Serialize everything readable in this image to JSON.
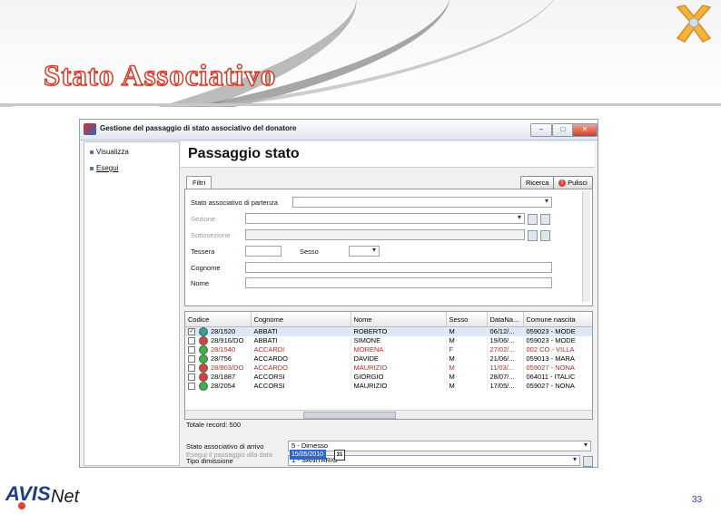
{
  "slide": {
    "title": "Stato Associativo",
    "page_number": "33",
    "logo_text": "AVISNet"
  },
  "window": {
    "title": "Gestione del passaggio di stato associativo del donatore",
    "minimize_label": "–",
    "maximize_label": "□",
    "close_label": "✕"
  },
  "sidebar": {
    "items": [
      {
        "label": "Visualizza"
      },
      {
        "label": "Esegui"
      }
    ]
  },
  "main": {
    "heading": "Passaggio stato",
    "tab_filters": "Filtri",
    "search_button": "Ricerca",
    "clear_button": "Pulisci"
  },
  "filters": {
    "stato_partenza_label": "Stato associativo di partenza",
    "sezione_label": "Sezione",
    "sottosezione_label": "Sottosezione",
    "tessera_label": "Tessera",
    "sesso_label": "Sesso",
    "cognome_label": "Cognome",
    "nome_label": "Nome"
  },
  "grid": {
    "columns": [
      "Codice",
      "Cognome",
      "Nome",
      "Sesso",
      "DataNa...",
      "Comune nascita"
    ],
    "rows": [
      {
        "check": "✓",
        "status": "teal",
        "codice": "28/1520",
        "cognome": "ABBATI",
        "nome": "ROBERTO",
        "sesso": "M",
        "data": "06/12/...",
        "comune": "059023 - MODE",
        "red": false,
        "selected": true
      },
      {
        "check": "",
        "status": "red",
        "codice": "28/916/DO",
        "cognome": "ABBATI",
        "nome": "SIMONE",
        "sesso": "M",
        "data": "19/06/...",
        "comune": "059023 - MODE",
        "red": false,
        "selected": false
      },
      {
        "check": "",
        "status": "green",
        "codice": "28/1540",
        "cognome": "ACCARDI",
        "nome": "MORENA",
        "sesso": "F",
        "data": "27/02/...",
        "comune": "002 CO - VILLA",
        "red": true,
        "selected": false
      },
      {
        "check": "",
        "status": "green",
        "codice": "28/756",
        "cognome": "ACCARDO",
        "nome": "DAVIDE",
        "sesso": "M",
        "data": "21/06/...",
        "comune": "059013 - MARA",
        "red": false,
        "selected": false
      },
      {
        "check": "",
        "status": "red",
        "codice": "28/803/DO",
        "cognome": "ACCARDO",
        "nome": "MAURIZIO",
        "sesso": "M",
        "data": "11/03/...",
        "comune": "059027 - NONA",
        "red": true,
        "selected": false
      },
      {
        "check": "",
        "status": "red",
        "codice": "28/1887",
        "cognome": "ACCORSI",
        "nome": "GIORGIO",
        "sesso": "M",
        "data": "28/07/...",
        "comune": "064011 - ITALIC",
        "red": false,
        "selected": false
      },
      {
        "check": "",
        "status": "green",
        "codice": "28/2054",
        "cognome": "ACCORSI",
        "nome": "MAURIZIO",
        "sesso": "M",
        "data": "17/05/...",
        "comune": "059027 - NONA",
        "red": false,
        "selected": false
      }
    ],
    "total_label": "Totale record: 500"
  },
  "bottom": {
    "stato_arrivo_label": "Stato associativo di arrivo",
    "stato_arrivo_value": "5 - Dimesso",
    "tipo_dimissione_label": "Tipo dimissione",
    "tipo_dimissione_value": "1 - SANITARIO",
    "esegui_label": "Esegui il passaggio alla data",
    "esegui_date": "15/05/2010",
    "calendar_label": "31"
  },
  "colors": {
    "title_red": "#d33d2a",
    "status_teal": "#2aa6a0",
    "status_red": "#d9443a",
    "status_green": "#3bb54a",
    "selection_blue": "#3366cc"
  }
}
